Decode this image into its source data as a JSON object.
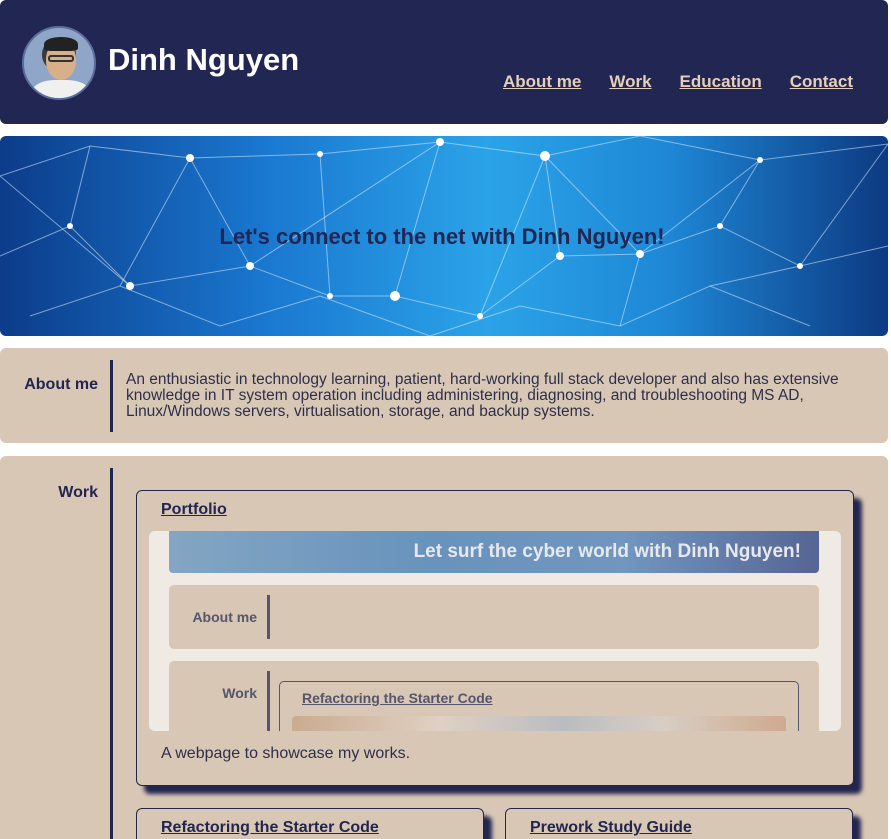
{
  "header": {
    "name": "Dinh Nguyen",
    "nav": [
      "About me",
      "Work",
      "Education",
      "Contact"
    ]
  },
  "hero": {
    "tagline": "Let's connect to the net with Dinh Nguyen!"
  },
  "about": {
    "label": "About me",
    "text": "An enthusiastic in technology learning, patient, hard-working full stack developer and also has extensive knowledge in IT system operation including administering, diagnosing, and troubleshooting MS AD, Linux/Windows servers, virtualisation, storage, and backup systems."
  },
  "work": {
    "label": "Work",
    "projects": [
      {
        "title": "Portfolio",
        "description": "A webpage to showcase my works.",
        "preview": {
          "banner": "Let surf the cyber world with Dinh Nguyen!",
          "about_label": "About me",
          "work_label": "Work",
          "inner_card_title": "Refactoring the Starter Code"
        }
      },
      {
        "title": "Refactoring the Starter Code"
      },
      {
        "title": "Prework Study Guide"
      }
    ]
  },
  "colors": {
    "navy": "#212653",
    "tan": "#d9c7b6",
    "nav_link": "#e6cfb9"
  }
}
